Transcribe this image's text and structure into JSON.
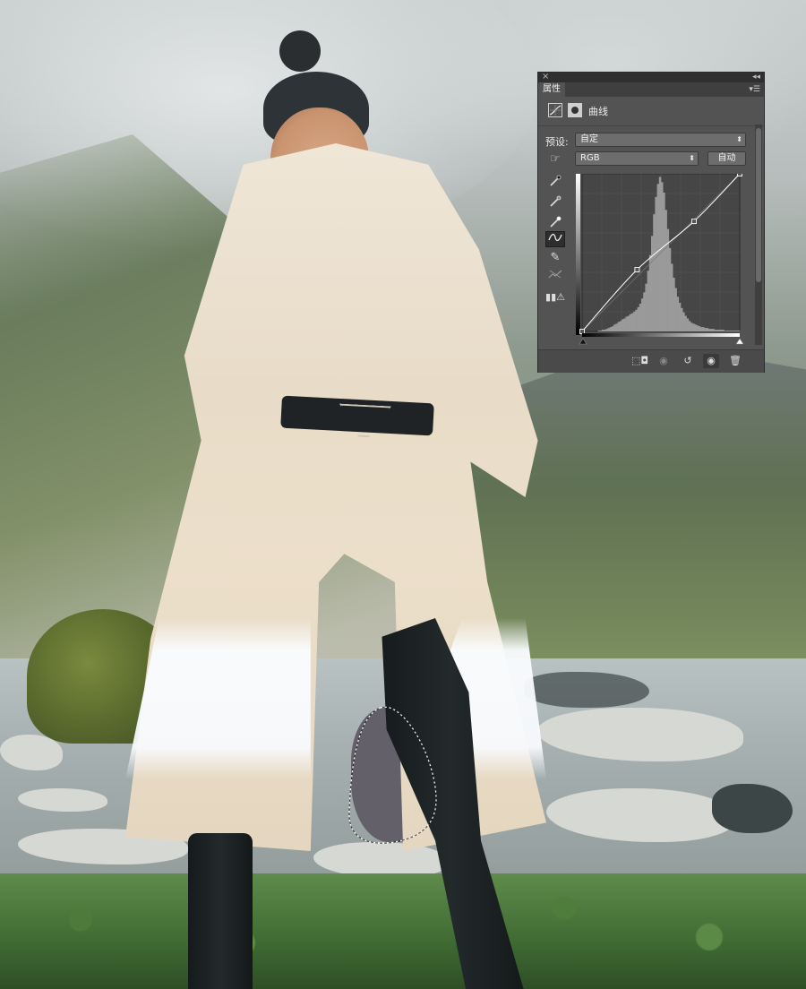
{
  "panel": {
    "tab_label": "属性",
    "name": "曲线",
    "preset_label": "预设:",
    "preset_value": "自定",
    "channel_value": "RGB",
    "auto_label": "自动"
  },
  "icons": {
    "close": "close-icon",
    "collapse": "double-chevron-icon",
    "menu": "panel-menu-icon",
    "curves": "curves-adjustment-icon",
    "mask": "layer-mask-icon",
    "target": "hand-target-adjust-icon",
    "eyedropper_black": "black-point-eyedropper-icon",
    "eyedropper_gray": "gray-point-eyedropper-icon",
    "eyedropper_white": "white-point-eyedropper-icon",
    "curve_tool": "edit-points-curve-icon",
    "pencil": "pencil-draw-icon",
    "smooth": "smooth-curve-icon",
    "clipping": "clipping-warning-icon",
    "clip_to_layer": "clip-to-layer-icon",
    "view_previous": "view-previous-state-icon",
    "reset": "reset-icon",
    "visibility": "eye-icon",
    "trash": "trash-icon"
  },
  "curve": {
    "points": [
      [
        0,
        0
      ],
      [
        89,
        100
      ],
      [
        181,
        178
      ],
      [
        255,
        255
      ]
    ],
    "histogram": [
      0,
      0,
      0,
      0,
      0,
      0,
      0,
      0,
      1,
      1,
      2,
      2,
      3,
      4,
      5,
      6,
      8,
      9,
      11,
      12,
      14,
      15,
      17,
      18,
      20,
      21,
      23,
      25,
      28,
      32,
      38,
      45,
      55,
      70,
      88,
      110,
      135,
      155,
      170,
      178,
      172,
      160,
      140,
      118,
      96,
      78,
      62,
      50,
      40,
      33,
      27,
      22,
      18,
      15,
      12,
      10,
      9,
      8,
      7,
      6,
      5,
      5,
      4,
      4,
      3,
      3,
      3,
      2,
      2,
      2,
      2,
      2,
      1,
      1,
      1,
      1,
      1,
      1,
      1,
      1
    ],
    "accent": "#ffffff"
  },
  "colors": {
    "panel_bg": "#535353",
    "titlebar": "#2f2f2f"
  }
}
